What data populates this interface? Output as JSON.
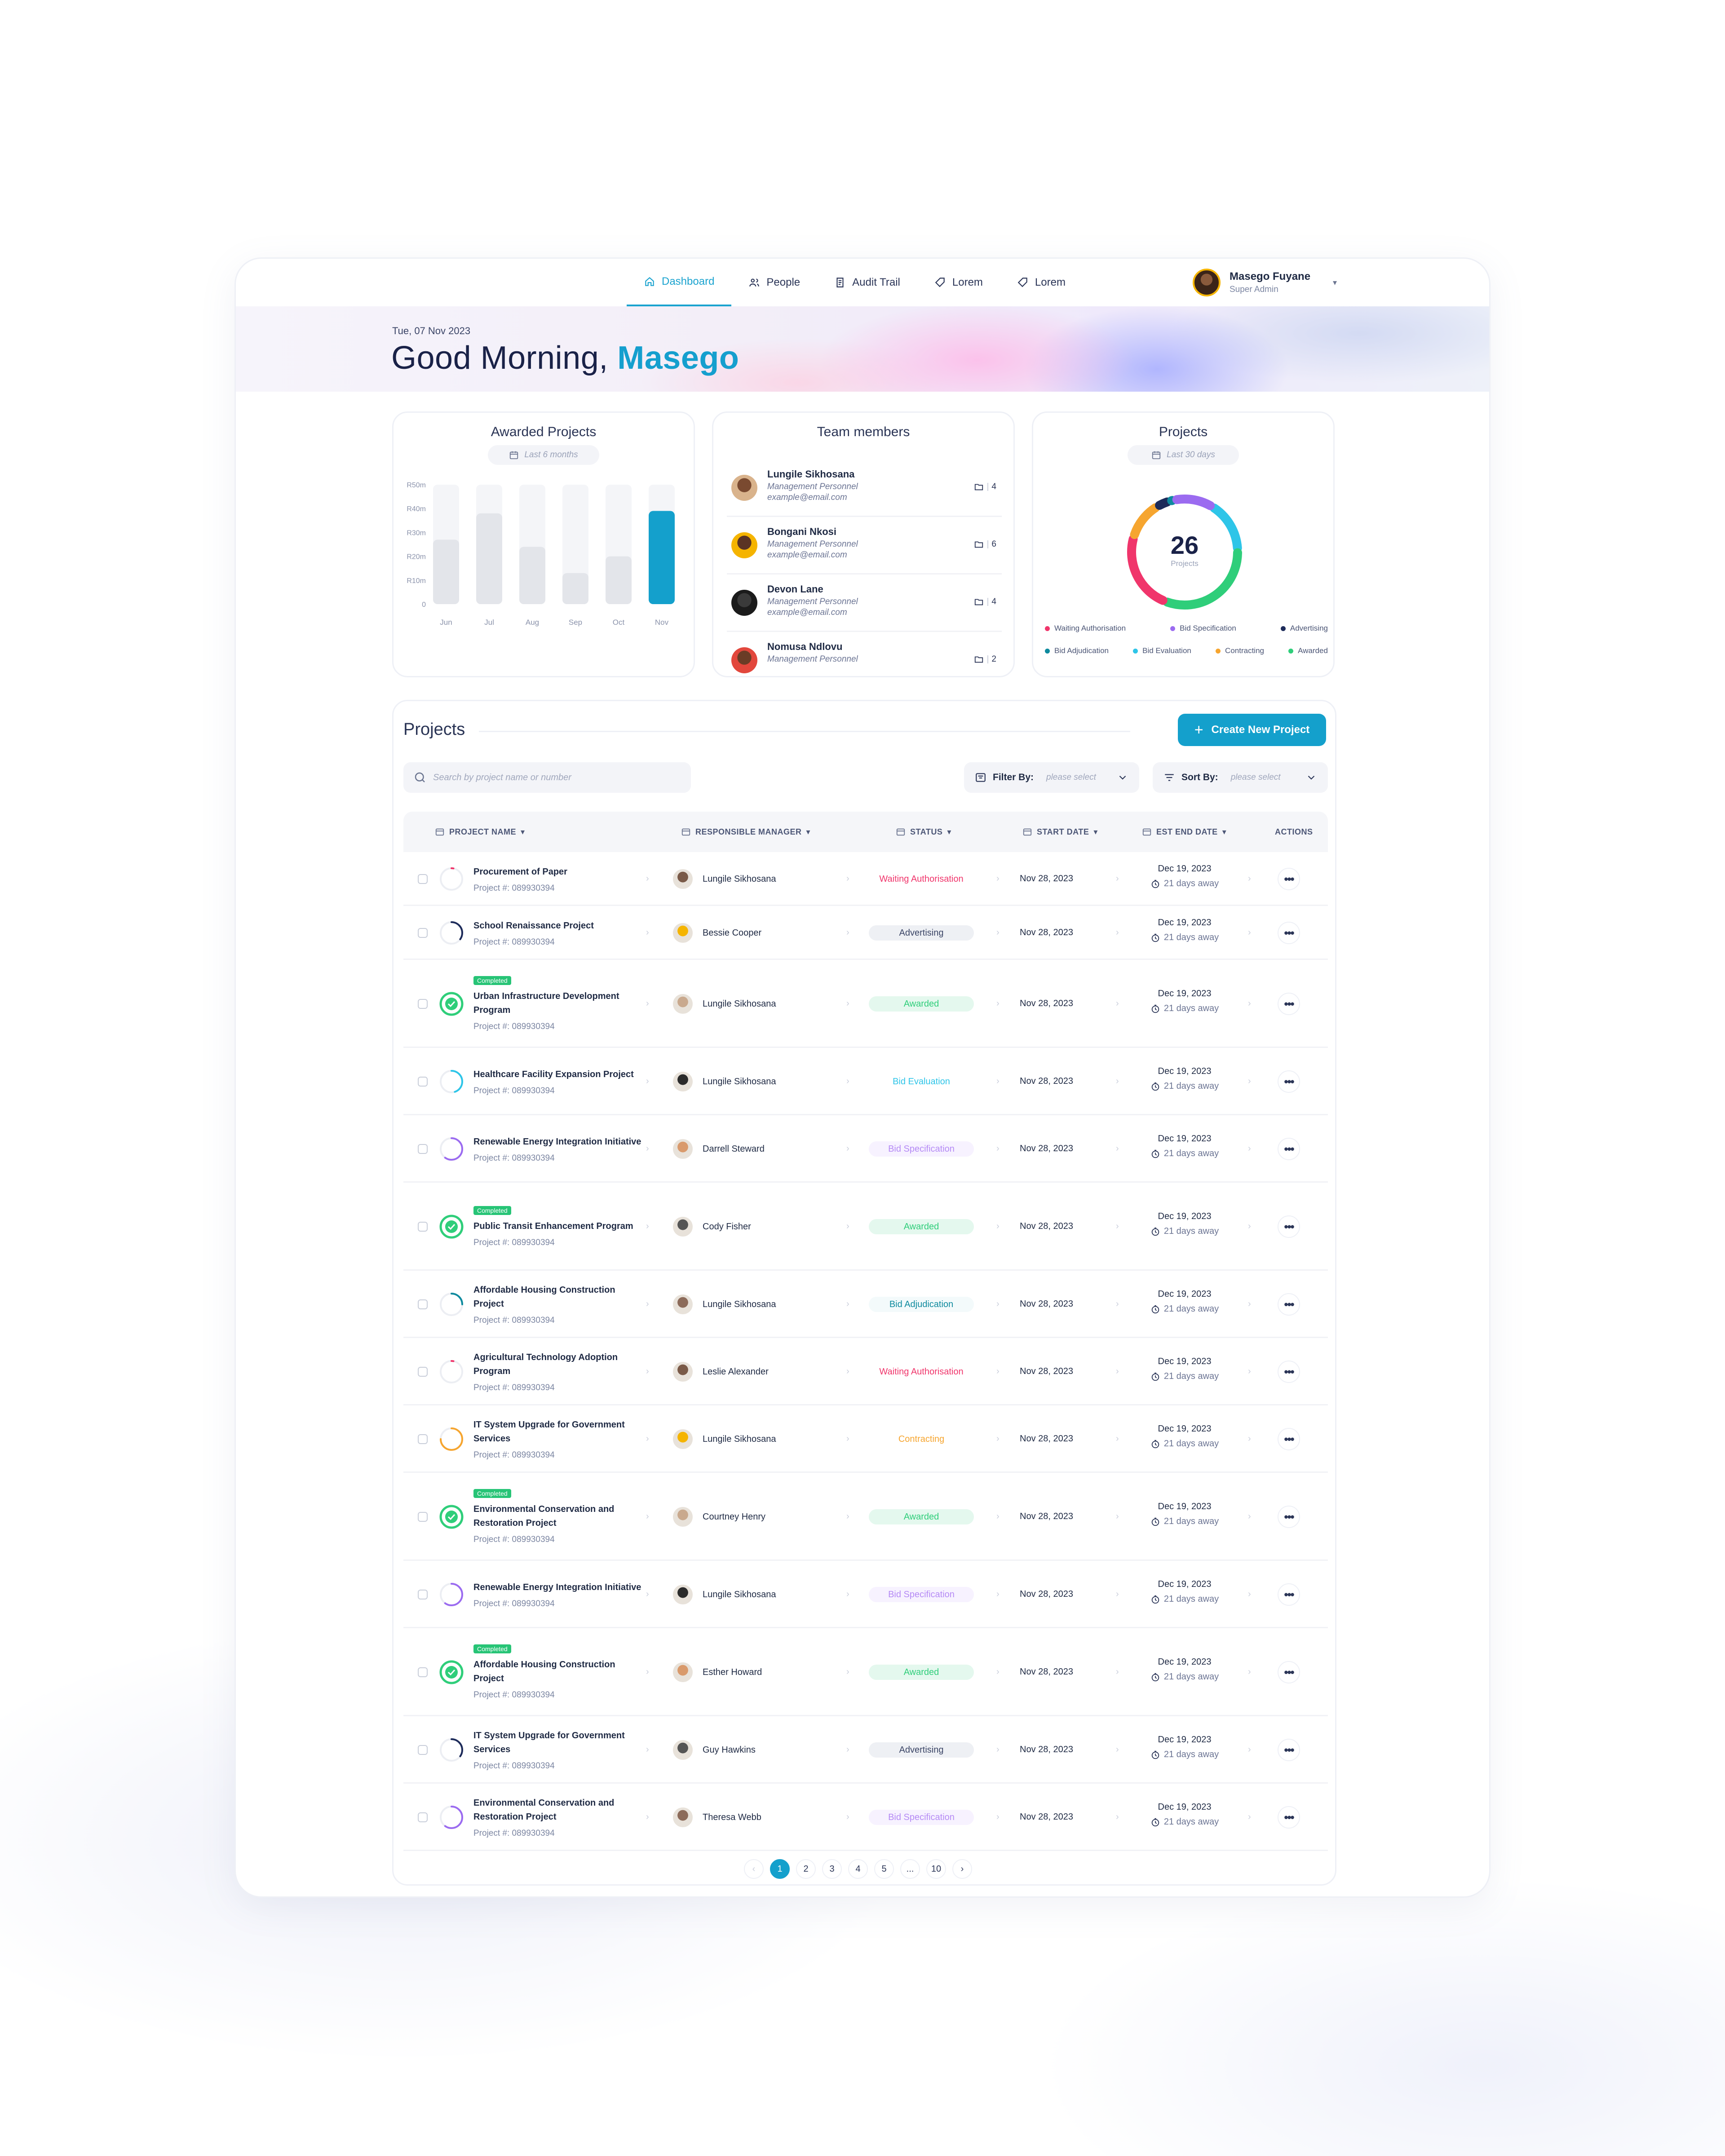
{
  "nav": {
    "tabs": [
      {
        "label": "Dashboard",
        "icon": "home-icon",
        "active": true
      },
      {
        "label": "People",
        "icon": "people-icon",
        "active": false
      },
      {
        "label": "Audit Trail",
        "icon": "audit-icon",
        "active": false
      },
      {
        "label": "Lorem",
        "icon": "tag-icon",
        "active": false
      },
      {
        "label": "Lorem",
        "icon": "tag-icon",
        "active": false
      }
    ],
    "user": {
      "name": "Masego Fuyane",
      "role": "Super Admin"
    }
  },
  "hero": {
    "date": "Tue, 07 Nov 2023",
    "greeting": "Good Morning,",
    "name": "Masego"
  },
  "awarded": {
    "title": "Awarded Projects",
    "range": "Last 6 months",
    "chart_data": {
      "type": "bar",
      "categories": [
        "Jun",
        "Jul",
        "Aug",
        "Sep",
        "Oct",
        "Nov"
      ],
      "values": [
        27,
        38,
        24,
        13,
        20,
        39
      ],
      "ylim": [
        0,
        50
      ],
      "yticks": [
        "0",
        "R10m",
        "R20m",
        "R30m",
        "R40m",
        "R50m"
      ],
      "highlight_color": "#14a0cc",
      "bar_color": "#e3e5ea",
      "track_color": "#f4f5f8"
    }
  },
  "team": {
    "title": "Team members",
    "members": [
      {
        "name": "Lungile Sikhosana",
        "role": "Management Personnel",
        "email": "example@email.com",
        "count": "4"
      },
      {
        "name": "Bongani Nkosi",
        "role": "Management Personnel",
        "email": "example@email.com",
        "count": "6"
      },
      {
        "name": "Devon Lane",
        "role": "Management Personnel",
        "email": "example@email.com",
        "count": "4"
      },
      {
        "name": "Nomusa Ndlovu",
        "role": "Management Personnel",
        "email": "",
        "count": "2"
      }
    ]
  },
  "projects_card": {
    "title": "Projects",
    "range": "Last 30 days",
    "total": "26",
    "total_label": "Projects",
    "chart_data": {
      "type": "pie",
      "labels": [
        "Waiting Authorisation",
        "Bid Specification",
        "Advertising",
        "Bid Adjudication",
        "Bid Evaluation",
        "Contracting",
        "Awarded"
      ],
      "values": [
        6,
        3,
        1,
        0.4,
        4,
        3,
        8
      ],
      "colors": [
        "#f0356b",
        "#9b6bf0",
        "#1d2b5a",
        "#0e8a9e",
        "#2ec5e8",
        "#f6a52f",
        "#2fce7a"
      ]
    }
  },
  "projects": {
    "title": "Projects",
    "create_label": "Create New Project",
    "search_placeholder": "Search by project name or number",
    "filter_label": "Filter By:",
    "sort_label": "Sort By:",
    "select_placeholder": "please select",
    "columns": [
      "PROJECT NAME",
      "RESPONSIBLE MANAGER",
      "STATUS",
      "START DATE",
      "EST END DATE",
      "ACTIONS"
    ],
    "completed_label": "Completed",
    "rows": [
      {
        "name": "Procurement of Paper",
        "num": "Project #: 089930394",
        "manager": "Lungile Sikhosana",
        "status": "Waiting Authorisation",
        "start": "Nov 28, 2023",
        "end": "Dec 19, 2023",
        "away": "21 days away",
        "completed": false,
        "progress": 0.03,
        "color": "#f0356b"
      },
      {
        "name": "School Renaissance Project",
        "num": "Project #: 089930394",
        "manager": "Bessie Cooper",
        "status": "Advertising",
        "start": "Nov 28, 2023",
        "end": "Dec 19, 2023",
        "away": "21 days away",
        "completed": false,
        "progress": 0.35,
        "color": "#1d2b5a"
      },
      {
        "name": "Urban Infrastructure Development Program",
        "num": "Project #: 089930394",
        "manager": "Lungile Sikhosana",
        "status": "Awarded",
        "start": "Nov 28, 2023",
        "end": "Dec 19, 2023",
        "away": "21 days away",
        "completed": true,
        "progress": 1,
        "color": "#2fce7a"
      },
      {
        "name": "Healthcare Facility Expansion Project",
        "num": "Project #: 089930394",
        "manager": "Lungile Sikhosana",
        "status": "Bid Evaluation",
        "start": "Nov 28, 2023",
        "end": "Dec 19, 2023",
        "away": "21 days away",
        "completed": false,
        "progress": 0.45,
        "color": "#2ec5e8"
      },
      {
        "name": "Renewable Energy Integration Initiative",
        "num": "Project #: 089930394",
        "manager": "Darrell Steward",
        "status": "Bid Specification",
        "start": "Nov 28, 2023",
        "end": "Dec 19, 2023",
        "away": "21 days away",
        "completed": false,
        "progress": 0.6,
        "color": "#9b6bf0"
      },
      {
        "name": "Public Transit Enhancement Program",
        "num": "Project #: 089930394",
        "manager": "Cody Fisher",
        "status": "Awarded",
        "start": "Nov 28, 2023",
        "end": "Dec 19, 2023",
        "away": "21 days away",
        "completed": true,
        "progress": 1,
        "color": "#2fce7a"
      },
      {
        "name": "Affordable Housing Construction Project",
        "num": "Project #: 089930394",
        "manager": "Lungile Sikhosana",
        "status": "Bid Adjudication",
        "start": "Nov 28, 2023",
        "end": "Dec 19, 2023",
        "away": "21 days away",
        "completed": false,
        "progress": 0.25,
        "color": "#0e8a9e"
      },
      {
        "name": "Agricultural Technology Adoption Program",
        "num": "Project #: 089930394",
        "manager": "Leslie Alexander",
        "status": "Waiting Authorisation",
        "start": "Nov 28, 2023",
        "end": "Dec 19, 2023",
        "away": "21 days away",
        "completed": false,
        "progress": 0.03,
        "color": "#f0356b"
      },
      {
        "name": "IT System Upgrade for Government Services",
        "num": "Project #: 089930394",
        "manager": "Lungile Sikhosana",
        "status": "Contracting",
        "start": "Nov 28, 2023",
        "end": "Dec 19, 2023",
        "away": "21 days away",
        "completed": false,
        "progress": 0.75,
        "color": "#f6a52f"
      },
      {
        "name": "Environmental Conservation and Restoration Project",
        "num": "Project #: 089930394",
        "manager": "Courtney Henry",
        "status": "Awarded",
        "start": "Nov 28, 2023",
        "end": "Dec 19, 2023",
        "away": "21 days away",
        "completed": true,
        "progress": 1,
        "color": "#2fce7a"
      },
      {
        "name": "Renewable Energy Integration Initiative",
        "num": "Project #: 089930394",
        "manager": "Lungile Sikhosana",
        "status": "Bid Specification",
        "start": "Nov 28, 2023",
        "end": "Dec 19, 2023",
        "away": "21 days away",
        "completed": false,
        "progress": 0.6,
        "color": "#9b6bf0"
      },
      {
        "name": "Affordable Housing Construction Project",
        "num": "Project #: 089930394",
        "manager": "Esther Howard",
        "status": "Awarded",
        "start": "Nov 28, 2023",
        "end": "Dec 19, 2023",
        "away": "21 days away",
        "completed": true,
        "progress": 1,
        "color": "#2fce7a"
      },
      {
        "name": "IT System Upgrade for Government Services",
        "num": "Project #: 089930394",
        "manager": "Guy Hawkins",
        "status": "Advertising",
        "start": "Nov 28, 2023",
        "end": "Dec 19, 2023",
        "away": "21 days away",
        "completed": false,
        "progress": 0.35,
        "color": "#1d2b5a"
      },
      {
        "name": "Environmental Conservation and Restoration Project",
        "num": "Project #: 089930394",
        "manager": "Theresa Webb",
        "status": "Bid Specification",
        "start": "Nov 28, 2023",
        "end": "Dec 19, 2023",
        "away": "21 days away",
        "completed": false,
        "progress": 0.6,
        "color": "#9b6bf0"
      }
    ],
    "status_styles": {
      "Waiting Authorisation": {
        "fg": "#f0356b",
        "bg": "#ffffff"
      },
      "Advertising": {
        "fg": "#3b4566",
        "bg": "#eef0f4"
      },
      "Awarded": {
        "fg": "#2fce7a",
        "bg": "#e4f8ee"
      },
      "Bid Evaluation": {
        "fg": "#2ec5e8",
        "bg": "#ffffff"
      },
      "Bid Specification": {
        "fg": "#b58af5",
        "bg": "#f7f2ff"
      },
      "Bid Adjudication": {
        "fg": "#0e8a9e",
        "bg": "#f3fafb"
      },
      "Contracting": {
        "fg": "#f6a52f",
        "bg": "#ffffff"
      }
    },
    "pages": [
      "1",
      "2",
      "3",
      "4",
      "5",
      "...",
      "10"
    ],
    "current_page": "1"
  }
}
